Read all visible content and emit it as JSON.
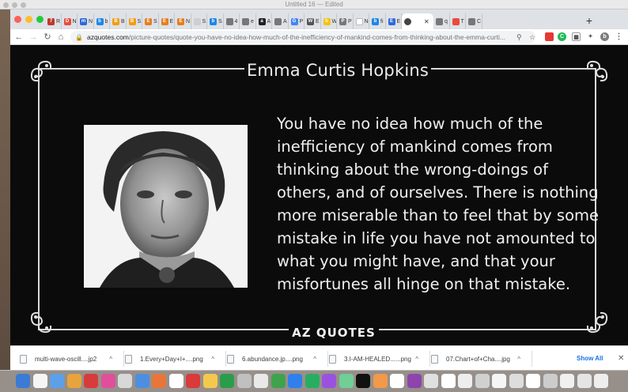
{
  "window": {
    "title": "Untitled 16 — Edited"
  },
  "browser": {
    "tabs": [
      {
        "letter": "7",
        "label": "R",
        "color": "#c0392b"
      },
      {
        "letter": "D",
        "label": "N",
        "color": "#e74c3c"
      },
      {
        "letter": "m",
        "label": "N",
        "color": "#2f6bd8"
      },
      {
        "letter": "b",
        "label": "b",
        "color": "#1e88e5"
      },
      {
        "letter": "B",
        "label": "B",
        "color": "#f39c12"
      },
      {
        "letter": "B",
        "label": "S",
        "color": "#f39c12"
      },
      {
        "letter": "E",
        "label": "S",
        "color": "#e67e22"
      },
      {
        "letter": "E",
        "label": "E",
        "color": "#e67e22"
      },
      {
        "letter": "E",
        "label": "N",
        "color": "#e67e22"
      },
      {
        "letter": "",
        "label": "S",
        "color": "#cfcfcf"
      },
      {
        "letter": "b",
        "label": "S",
        "color": "#1e88e5"
      },
      {
        "letter": "",
        "label": "4",
        "color": "#777"
      },
      {
        "letter": "",
        "label": "e",
        "color": "#777"
      },
      {
        "letter": "a",
        "label": "A",
        "color": "#222"
      },
      {
        "letter": "",
        "label": "A",
        "color": "#777"
      },
      {
        "letter": "G",
        "label": "P",
        "color": "#4285f4"
      },
      {
        "letter": "W",
        "label": "E",
        "color": "#555"
      },
      {
        "letter": "b",
        "label": "W",
        "color": "#f1c40f"
      },
      {
        "letter": "P",
        "label": "P",
        "color": "#777"
      },
      {
        "letter": "",
        "label": "New",
        "color": "#ffffff"
      },
      {
        "letter": "b",
        "label": "fi",
        "color": "#1e88e5"
      },
      {
        "letter": "E",
        "label": "E",
        "color": "#2f6bd8"
      }
    ],
    "tabs_after_active": [
      {
        "letter": "",
        "label": "q",
        "color": "#777"
      },
      {
        "letter": "",
        "label": "T",
        "color": "#e74c3c"
      },
      {
        "letter": "",
        "label": "C",
        "color": "#777"
      }
    ],
    "new_tab_label": "+",
    "url_domain": "azquotes.com",
    "url_path": "/picture-quotes/quote-you-have-no-idea-how-much-of-the-inefficiency-of-mankind-comes-from-thinking-about-the-emma-curti..."
  },
  "page": {
    "author": "Emma Curtis Hopkins",
    "quote": "You have no idea how much of the inefficiency of mankind comes from thinking about the wrong-doings of others, and of ourselves. There is nothing more miserable than to feel that by some mistake in life you have not amounted to what you might have, and that your misfortunes all hinge on that mistake.",
    "quote_lines": [
      "You have no idea how much of the",
      "inefficiency of mankind comes from",
      "thinking about the wrong-doings of",
      "others, and of ourselves. There is nothing",
      "more miserable than to feel that by some",
      "mistake in life you have not amounted to",
      "what you might have, and that your",
      "misfortunes all hinge on that mistake."
    ],
    "logo": "AZ QUOTES"
  },
  "downloads": {
    "items": [
      "multi-wave-oscill....jp2",
      "1.Every+Day+I+....png",
      "6.abundance.jp....png",
      "3.I-AM-HEALED......png",
      "07.Chart+of+Cha....jpg"
    ],
    "show_all": "Show All",
    "close": "✕"
  },
  "colors": {
    "page_bg": "#0b0b0b",
    "text": "#f0f0f0",
    "chrome_bg": "#dee1e6",
    "link_blue": "#1a73e8"
  }
}
